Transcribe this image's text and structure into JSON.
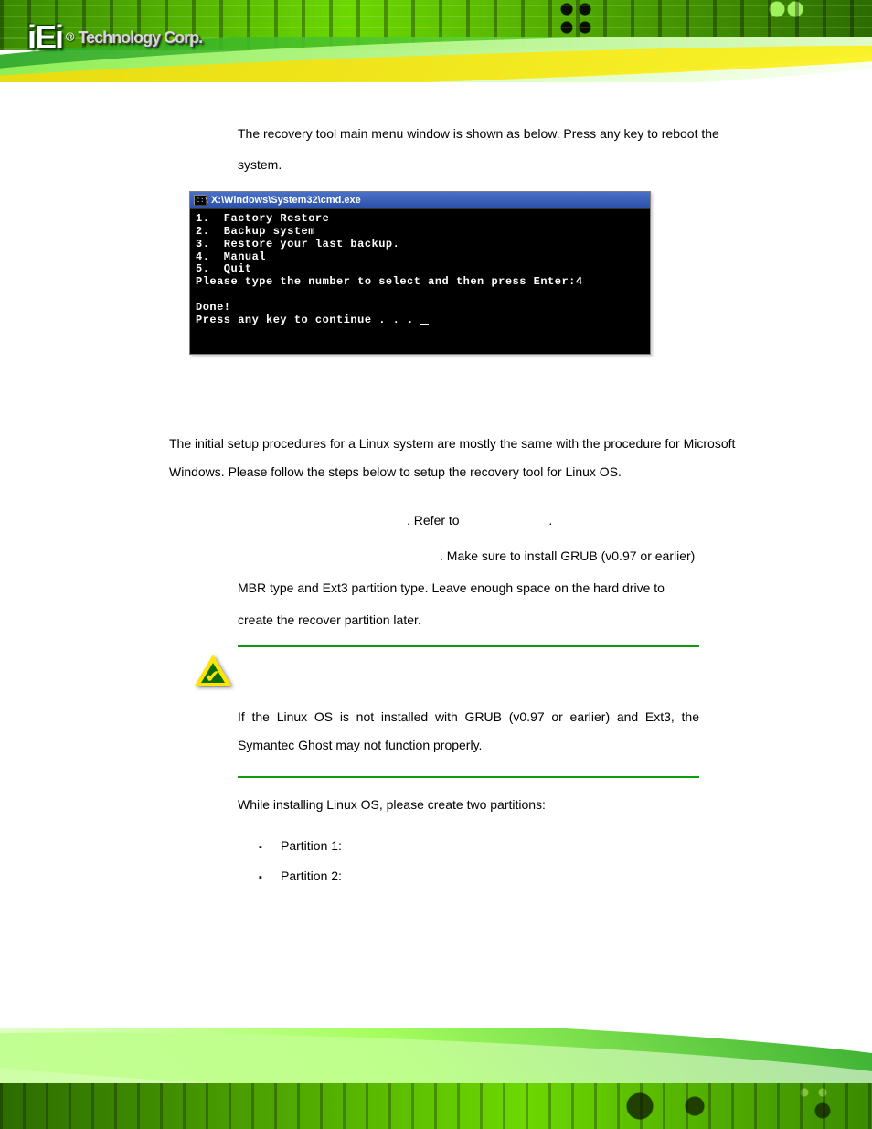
{
  "logo": {
    "brand": "iEi",
    "reg": "®",
    "tagline": "Technology Corp."
  },
  "intro": "The recovery tool main menu window is shown as below. Press any key to reboot the system.",
  "cmd": {
    "title": "X:\\Windows\\System32\\cmd.exe",
    "line1": "1.  Factory Restore",
    "line2": "2.  Backup system",
    "line3": "3.  Restore your last backup.",
    "line4": "4.  Manual",
    "line5": "5.  Quit",
    "prompt": "Please type the number to select and then press Enter:4",
    "done": "Done!",
    "cont": "Press any key to continue . . . "
  },
  "linux_intro": "The initial setup procedures for a Linux system are mostly the same with the procedure for Microsoft Windows. Please follow the steps below to setup the recovery tool for Linux OS.",
  "refer": ". Refer to",
  "period": ".",
  "grub_first": ". Make sure to install GRUB (v0.97 or earlier)",
  "grub_rest1": "MBR type and Ext3 partition type. Leave enough space on the hard drive to",
  "grub_rest2": "create the recover partition later.",
  "note": "If the Linux OS is not installed with GRUB (v0.97 or earlier) and Ext3, the Symantec Ghost may not function properly.",
  "while": "While installing Linux OS, please create two partitions:",
  "partitions": {
    "p1": "Partition 1:",
    "p2": "Partition 2:"
  }
}
